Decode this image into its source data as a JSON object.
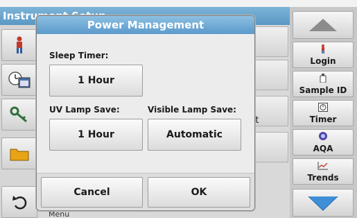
{
  "background": {
    "window_title": "Instrument Setup",
    "partial_row_text": "nt",
    "partial_bottom_text": "Menu"
  },
  "sidebar": {
    "up_icon": "triangle-up-icon",
    "down_icon": "chevron-down-icon",
    "items": [
      {
        "label": "Login",
        "icon": "person-icon"
      },
      {
        "label": "Sample ID",
        "icon": "bottle-icon"
      },
      {
        "label": "Timer",
        "icon": "timer-icon"
      },
      {
        "label": "AQA",
        "icon": "aqa-icon"
      },
      {
        "label": "Trends",
        "icon": "chart-icon"
      }
    ]
  },
  "dialog": {
    "title": "Power Management",
    "sleep_timer_label": "Sleep Timer:",
    "sleep_timer_value": "1 Hour",
    "uv_lamp_label": "UV Lamp Save:",
    "uv_lamp_value": "1 Hour",
    "visible_lamp_label": "Visible Lamp Save:",
    "visible_lamp_value": "Automatic",
    "cancel_label": "Cancel",
    "ok_label": "OK"
  },
  "colors": {
    "title_bar": "#5b9acb",
    "sidebar_arrow": "#4a8fd0"
  }
}
